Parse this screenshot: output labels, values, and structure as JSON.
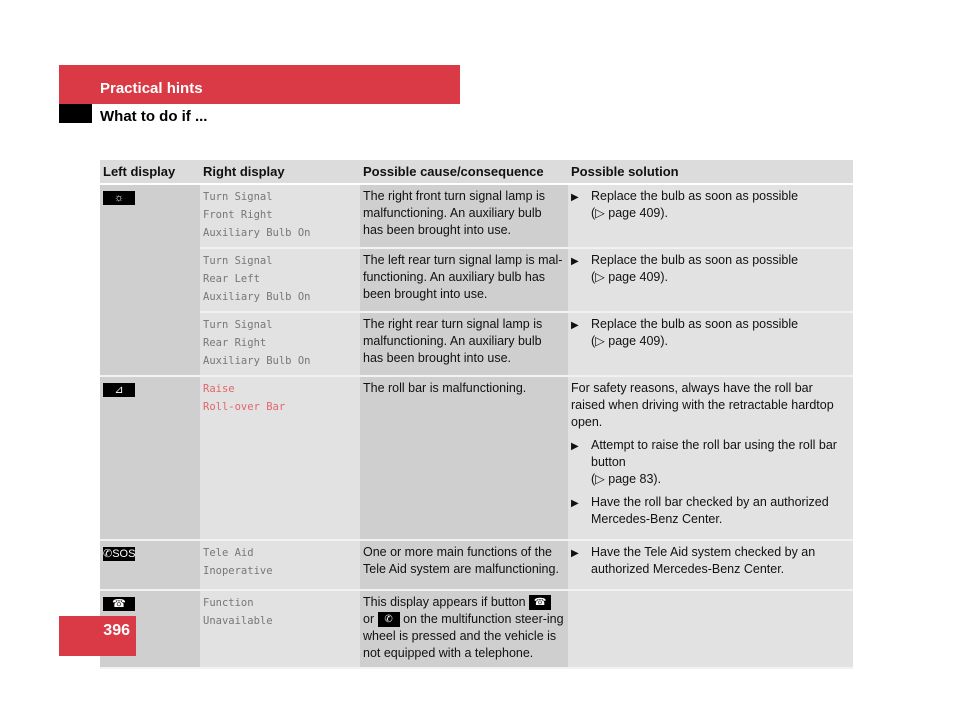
{
  "header": {
    "section": "Practical hints",
    "subsection": "What to do if ..."
  },
  "page_number": "396",
  "table": {
    "columns": [
      "Left display",
      "Right display",
      "Possible cause/consequence",
      "Possible solution"
    ],
    "groups": [
      {
        "icon": "turn-signal-bulb-icon",
        "glyph": "☼",
        "rows": [
          {
            "right": [
              "Turn Signal",
              "Front Right",
              "Auxiliary Bulb On"
            ],
            "cause": "The right front turn signal lamp is malfunctioning. An auxiliary bulb has been brought into use.",
            "solution": {
              "bullets": [
                {
                  "text": "Replace the bulb as soon as possible",
                  "ref": "(▷ page 409)."
                }
              ]
            }
          },
          {
            "right": [
              "Turn Signal",
              "Rear Left",
              "Auxiliary Bulb On"
            ],
            "cause": "The left rear turn signal lamp is mal-functioning. An auxiliary bulb has been brought into use.",
            "solution": {
              "bullets": [
                {
                  "text": "Replace the bulb as soon as possible",
                  "ref": "(▷ page 409)."
                }
              ]
            }
          },
          {
            "right": [
              "Turn Signal",
              "Rear Right",
              "Auxiliary Bulb On"
            ],
            "cause": "The right rear turn signal lamp is malfunctioning. An auxiliary bulb has been brought into use.",
            "solution": {
              "bullets": [
                {
                  "text": "Replace the bulb as soon as possible",
                  "ref": "(▷ page 409)."
                }
              ]
            }
          }
        ]
      },
      {
        "icon": "roll-bar-icon",
        "glyph": "⊿",
        "rows": [
          {
            "right": [
              "Raise",
              "Roll-over Bar"
            ],
            "right_color": "red",
            "cause": "The roll bar is malfunctioning.",
            "solution": {
              "intro": "For safety reasons, always have the roll bar raised when driving with the retractable hardtop open.",
              "bullets": [
                {
                  "text": "Attempt to raise the roll bar using the roll bar button",
                  "ref": "(▷ page 83)."
                },
                {
                  "text": "Have the roll bar checked by an authorized Mercedes-Benz Center.",
                  "ref": ""
                }
              ]
            }
          }
        ]
      },
      {
        "icon": "tele-aid-sos-icon",
        "glyph": "✆SOS",
        "rows": [
          {
            "right": [
              "Tele Aid",
              "Inoperative"
            ],
            "cause": "One or more main functions of the Tele Aid system are malfunctioning.",
            "solution": {
              "bullets": [
                {
                  "text": "Have the Tele Aid system checked by an authorized Mercedes-Benz Center.",
                  "ref": ""
                }
              ]
            }
          }
        ]
      },
      {
        "icon": "phone-hang-up-icon",
        "glyph": "☎",
        "rows": [
          {
            "right": [
              "Function",
              "Unavailable"
            ],
            "cause_parts": [
              "This display appears if button",
              "or",
              "on the multifunction steer-ing wheel is pressed and the vehicle is not equipped with a telephone."
            ],
            "solution": {
              "bullets": []
            }
          }
        ]
      }
    ]
  }
}
